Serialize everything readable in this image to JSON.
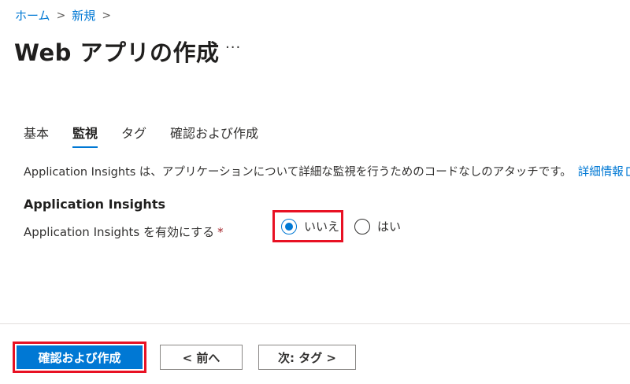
{
  "breadcrumb": {
    "items": [
      "ホーム",
      "新規"
    ],
    "separator": ">"
  },
  "page": {
    "title": "Web アプリの作成",
    "more_icon": "ellipsis-icon"
  },
  "tabs": [
    {
      "label": "基本",
      "active": false
    },
    {
      "label": "監視",
      "active": true
    },
    {
      "label": "タグ",
      "active": false
    },
    {
      "label": "確認および作成",
      "active": false
    }
  ],
  "description": {
    "text": "Application Insights は、アプリケーションについて詳細な監視を行うためのコードなしのアタッチです。",
    "link_label": "詳細情報",
    "link_icon": "external-link-icon"
  },
  "section": {
    "title": "Application Insights",
    "field_label": "Application Insights を有効にする",
    "required_mark": "*",
    "options": [
      {
        "label": "いいえ",
        "selected": true
      },
      {
        "label": "はい",
        "selected": false
      }
    ]
  },
  "footer": {
    "review_create_label": "確認および作成",
    "prev_label": "< 前へ",
    "next_label": "次: タグ >"
  },
  "colors": {
    "accent": "#0078d4",
    "highlight": "#e81123",
    "required": "#a4262c"
  }
}
